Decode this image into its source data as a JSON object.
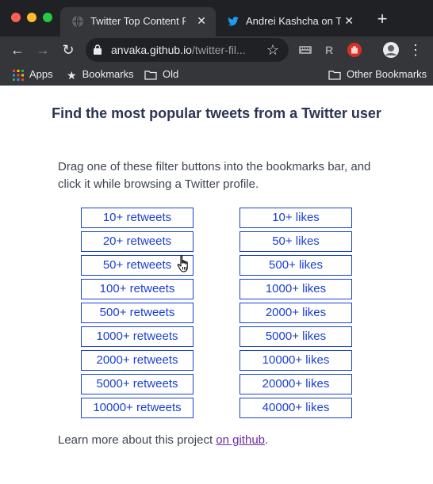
{
  "tabs": [
    {
      "title": "Twitter Top Content Filte",
      "icon": "globe-icon",
      "active": true
    },
    {
      "title": "Andrei Kashcha on Twitte",
      "icon": "twitter-bird-icon",
      "active": false
    }
  ],
  "address": {
    "host": "anvaka.github.io",
    "path": "/twitter-fil..."
  },
  "extensions": [
    "keyboard-extension-icon",
    "r-extension-icon",
    "hand-extension-icon",
    "profile-avatar"
  ],
  "bookmarks": {
    "apps": "Apps",
    "bookmarks": "Bookmarks",
    "old": "Old",
    "other": "Other Bookmarks"
  },
  "page": {
    "heading": "Find the most popular tweets from a Twitter user",
    "intro": "Drag one of these filter buttons into the bookmarks bar, and click it while browsing a Twitter profile.",
    "retweet_buttons": [
      "10+ retweets",
      "20+ retweets",
      "50+ retweets",
      "100+ retweets",
      "500+ retweets",
      "1000+ retweets",
      "2000+ retweets",
      "5000+ retweets",
      "10000+ retweets"
    ],
    "like_buttons": [
      "10+ likes",
      "50+ likes",
      "500+ likes",
      "1000+ likes",
      "2000+ likes",
      "5000+ likes",
      "10000+ likes",
      "20000+ likes",
      "40000+ likes"
    ],
    "footer_text": "Learn more about this project ",
    "footer_link": "on github",
    "footer_end": "."
  },
  "colors": {
    "accent": "#1a3fd6",
    "link_visited": "#6b2aa4",
    "heading": "#2b3454"
  }
}
